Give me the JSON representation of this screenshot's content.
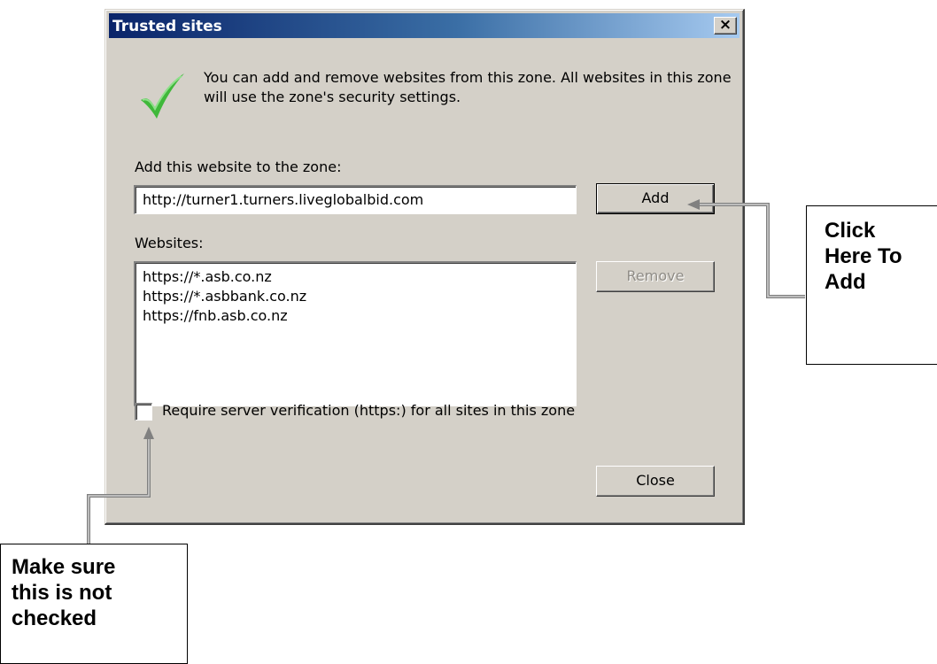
{
  "window": {
    "title": "Trusted sites",
    "close_glyph": "×"
  },
  "info": {
    "icon": "green-checkmark-icon",
    "text": "You can add and remove websites from this zone. All websites in this zone will use the zone's security settings."
  },
  "add_section": {
    "label": "Add this website to the zone:",
    "input_value": "http://turner1.turners.liveglobalbid.com",
    "add_label": "Add"
  },
  "websites": {
    "label": "Websites:",
    "items": [
      "https://*.asb.co.nz",
      "https://*.asbbank.co.nz",
      "https://fnb.asb.co.nz"
    ],
    "remove_label": "Remove"
  },
  "verification": {
    "label": "Require server verification (https:) for all sites in this zone",
    "checked": false
  },
  "footer": {
    "close_label": "Close"
  },
  "callouts": {
    "add": [
      "Click",
      "Here To",
      "Add"
    ],
    "checkbox": [
      "Make sure",
      "this is not",
      "checked"
    ]
  },
  "colors": {
    "titlebar_start": "#0a246a",
    "titlebar_end": "#a6caf0",
    "dialog_face": "#d4d0c8",
    "check_green": "#3fb83a"
  }
}
